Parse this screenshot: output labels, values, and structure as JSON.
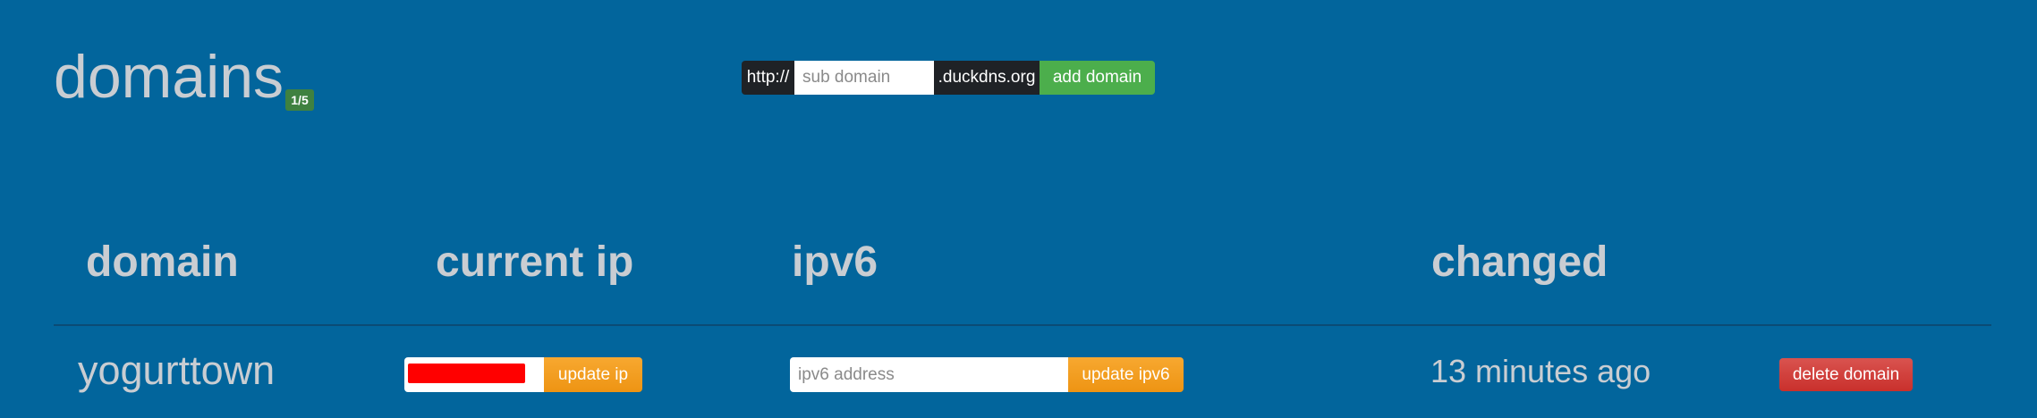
{
  "header": {
    "title": "domains",
    "count_badge": "1/5"
  },
  "add_form": {
    "prefix": "http://",
    "placeholder": "sub domain",
    "value": "",
    "suffix": ".duckdns.org",
    "add_label": "add domain"
  },
  "table": {
    "columns": [
      "domain",
      "current ip",
      "ipv6",
      "changed"
    ],
    "rows": [
      {
        "domain": "yogurttown",
        "current_ip": "",
        "update_ip_label": "update ip",
        "ipv6_placeholder": "ipv6 address",
        "ipv6_value": "",
        "update_ipv6_label": "update ipv6",
        "changed": "13 minutes ago",
        "delete_label": "delete domain"
      }
    ]
  },
  "colors": {
    "background": "#02659c",
    "text": "#c9cdd2",
    "badge": "#3f8140",
    "add_button": "#4cae4c",
    "update_button": "#f0a020",
    "delete_button": "#d1423f",
    "redaction": "#ff0000"
  }
}
